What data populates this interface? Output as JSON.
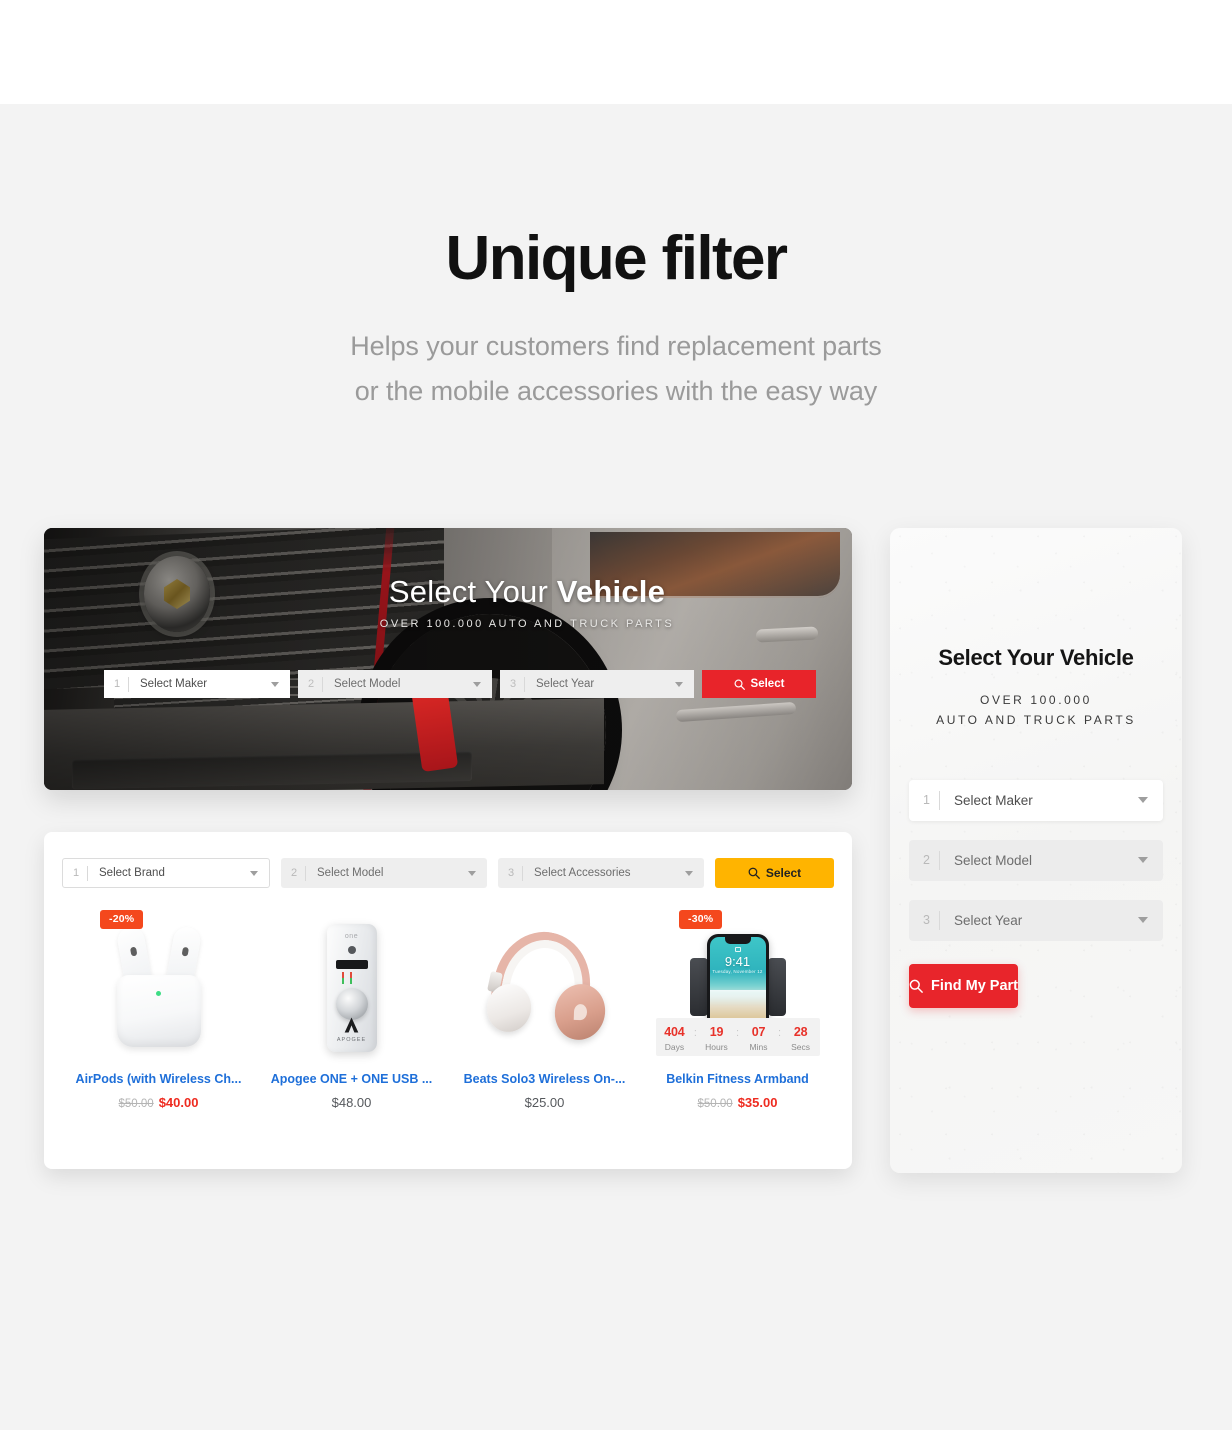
{
  "hero": {
    "title": "Unique filter",
    "subtitle_line1": "Helps your customers find replacement parts",
    "subtitle_line2": "or the mobile accessories with the easy way"
  },
  "vehicle_banner": {
    "title_light": "Select Your ",
    "title_bold": "Vehicle",
    "subtitle": "OVER 100.000 AUTO AND TRUCK PARTS",
    "filters": [
      {
        "num": "1",
        "value": "Select Maker",
        "state": "active"
      },
      {
        "num": "2",
        "value": "Select Model",
        "state": "disabled"
      },
      {
        "num": "3",
        "value": "Select Year",
        "state": "disabled"
      }
    ],
    "button_label": "Select",
    "button_color": "#e8242a"
  },
  "accessories_card": {
    "filters": [
      {
        "num": "1",
        "value": "Select Brand",
        "state": "active"
      },
      {
        "num": "2",
        "value": "Select Model",
        "state": "disabled"
      },
      {
        "num": "3",
        "value": "Select Accessories",
        "state": "disabled"
      }
    ],
    "button_label": "Select",
    "button_color": "#ffb400",
    "products": [
      {
        "name": "AirPods (with Wireless Ch...",
        "badge": "-20%",
        "old_price": "$50.00",
        "price": "$40.00",
        "on_sale": true
      },
      {
        "name": "Apogee ONE + ONE USB ...",
        "badge": "",
        "old_price": "",
        "price": "$48.00",
        "on_sale": false
      },
      {
        "name": "Beats Solo3 Wireless On-...",
        "badge": "",
        "old_price": "",
        "price": "$25.00",
        "on_sale": false
      },
      {
        "name": "Belkin Fitness Armband",
        "badge": "-30%",
        "old_price": "$50.00",
        "price": "$35.00",
        "on_sale": true,
        "countdown": {
          "days": "404",
          "hours": "19",
          "mins": "07",
          "secs": "28",
          "days_label": "Days",
          "hours_label": "Hours",
          "mins_label": "Mins",
          "secs_label": "Secs",
          "separator": ":"
        }
      }
    ],
    "phone_screen": {
      "time": "9:41",
      "date": "Tuesday, November 12"
    }
  },
  "side_panel": {
    "title": "Select Your Vehicle",
    "subtitle_line1": "OVER 100.000",
    "subtitle_line2": "AUTO AND TRUCK PARTS",
    "filters": [
      {
        "num": "1",
        "value": "Select Maker",
        "state": "active"
      },
      {
        "num": "2",
        "value": "Select Model",
        "state": "disabled"
      },
      {
        "num": "3",
        "value": "Select Year",
        "state": "disabled"
      }
    ],
    "cta_label": "Find My Part",
    "cta_color": "#e8252b"
  },
  "icons": {
    "search": "search-icon",
    "caret": "chevron-down-icon"
  },
  "colors": {
    "page_background": "#f3f3f3",
    "top_band": "#ffffff",
    "heading": "#111111",
    "subtext": "#9a9a9a",
    "product_link": "#1e6fd9",
    "sale_price": "#ee2b20",
    "badge": "#f4481d",
    "countdown_number": "#e8322a"
  }
}
